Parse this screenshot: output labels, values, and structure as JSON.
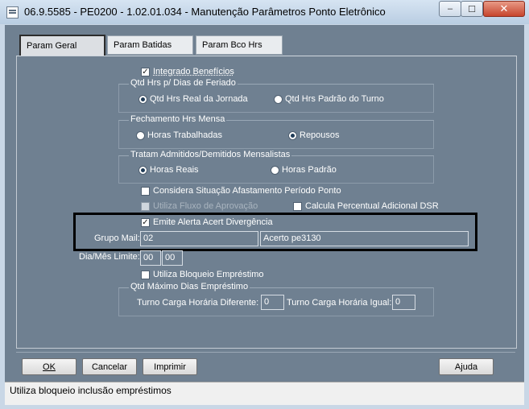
{
  "window": {
    "title": "06.9.5585 - PE0200 - 1.02.01.034 - Manutenção Parâmetros Ponto Eletrônico"
  },
  "tabs": [
    {
      "label": "Param Geral",
      "active": true
    },
    {
      "label": "Param Batidas",
      "active": false
    },
    {
      "label": "Param Bco Hrs",
      "active": false
    }
  ],
  "integrado": {
    "label": "Integrado Benefícios",
    "checked": true
  },
  "feriado": {
    "title": "Qtd Hrs p/ Dias de Feriado",
    "options": [
      "Qtd Hrs Real da Jornada",
      "Qtd Hrs Padrão do Turno"
    ],
    "selected": 0
  },
  "fechamento": {
    "title": "Fechamento Hrs Mensa",
    "options": [
      "Horas Trabalhadas",
      "Repousos"
    ],
    "selected": 1
  },
  "admitidos": {
    "title": "Tratam Admitidos/Demitidos Mensalistas",
    "options": [
      "Horas Reais",
      "Horas Padrão"
    ],
    "selected": 0
  },
  "considera": {
    "label": "Considera Situação Afastamento Período Ponto",
    "checked": false
  },
  "fluxo": {
    "label": "Utiliza Fluxo de Aprovação",
    "checked": false,
    "disabled": true
  },
  "calcula": {
    "label": "Calcula Percentual Adicional DSR",
    "checked": false
  },
  "emite": {
    "label": "Emite Alerta Acert Divergência",
    "checked": true
  },
  "grupo_mail": {
    "label": "Grupo Mail:",
    "code": "02",
    "desc": "Acerto pe3130"
  },
  "dia_mes": {
    "label": "Dia/Mês Limite:",
    "dia": "00",
    "mes": "00"
  },
  "bloqueio": {
    "label": "Utiliza Bloqueio Empréstimo",
    "checked": false
  },
  "emprestimo": {
    "title": "Qtd Máximo Dias Empréstimo",
    "diferente_label": "Turno Carga Horária Diferente:",
    "diferente_value": "0",
    "igual_label": "Turno Carga Horária Igual:",
    "igual_value": "0"
  },
  "buttons": {
    "ok": "OK",
    "cancelar": "Cancelar",
    "imprimir": "Imprimir",
    "ajuda": "Ajuda"
  },
  "status": "Utiliza bloqueio inclusão empréstimos"
}
